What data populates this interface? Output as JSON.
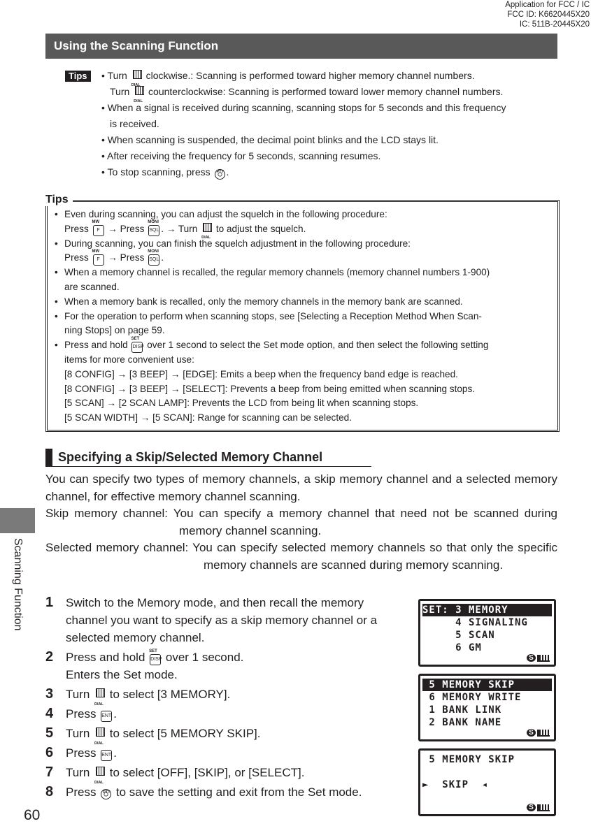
{
  "fcc_header": [
    "Application for FCC / IC",
    "FCC ID: K6620445X20",
    "IC: 511B-20445X20"
  ],
  "header": {
    "title": "Using the Scanning Function"
  },
  "tips_label": "Tips",
  "tips1": [
    {
      "cls": "",
      "seg": [
        {
          "t": "• Turn "
        },
        {
          "icon": "dial"
        },
        {
          "t": " clockwise.: Scanning is performed toward higher memory channel numbers."
        }
      ]
    },
    {
      "cls": "in",
      "seg": [
        {
          "t": "Turn "
        },
        {
          "icon": "dial"
        },
        {
          "t": " counterclockwise: Scanning is performed toward lower memory channel numbers."
        }
      ]
    },
    {
      "cls": "",
      "seg": [
        {
          "t": "• When a signal is received during scanning, scanning stops for 5 seconds and this frequency"
        }
      ]
    },
    {
      "cls": "in",
      "seg": [
        {
          "t": "is received."
        }
      ]
    },
    {
      "cls": "",
      "seg": [
        {
          "t": "• When scanning is suspended, the decimal point blinks and the LCD stays lit."
        }
      ]
    },
    {
      "cls": "",
      "seg": [
        {
          "t": "• After receiving the frequency for 5 seconds, scanning resumes."
        }
      ]
    },
    {
      "cls": "",
      "seg": [
        {
          "t": "• To stop scanning, press "
        },
        {
          "icon": "ptt"
        },
        {
          "t": "."
        }
      ]
    }
  ],
  "tips_box_label": "Tips",
  "tips2": [
    {
      "cls": "b",
      "seg": [
        {
          "t": "Even during scanning, you can adjust the squelch in the following procedure:"
        }
      ]
    },
    {
      "cls": "",
      "seg": [
        {
          "t": "Press "
        },
        {
          "icon": "key",
          "k": "F",
          "l": "MW"
        },
        {
          "t": " → Press "
        },
        {
          "icon": "key",
          "k": "SQL",
          "l": "MONI"
        },
        {
          "t": ". → Turn "
        },
        {
          "icon": "dial"
        },
        {
          "t": " to adjust the squelch."
        }
      ]
    },
    {
      "cls": "b",
      "seg": [
        {
          "t": "During scanning, you can finish the squelch adjustment in the following procedure:"
        }
      ]
    },
    {
      "cls": "",
      "seg": [
        {
          "t": "Press "
        },
        {
          "icon": "key",
          "k": "F",
          "l": "MW"
        },
        {
          "t": " → Press "
        },
        {
          "icon": "key",
          "k": "SQL",
          "l": "MONI"
        },
        {
          "t": "."
        }
      ]
    },
    {
      "cls": "b",
      "seg": [
        {
          "t": "When a memory channel is recalled, the regular memory channels (memory channel numbers 1-900)"
        }
      ]
    },
    {
      "cls": "",
      "seg": [
        {
          "t": "are scanned."
        }
      ]
    },
    {
      "cls": "b",
      "seg": [
        {
          "t": "When a memory bank is recalled, only the memory channels in the memory bank are scanned."
        }
      ]
    },
    {
      "cls": "b",
      "seg": [
        {
          "t": "For the operation to perform when scanning stops, see [Selecting a Reception Method When Scan-"
        }
      ]
    },
    {
      "cls": "",
      "seg": [
        {
          "t": "ning Stops] on page 59."
        }
      ]
    },
    {
      "cls": "b",
      "seg": [
        {
          "t": "Press and hold "
        },
        {
          "icon": "key",
          "k": "DISP",
          "l": "SET"
        },
        {
          "t": " over 1 second to select the Set mode option, and then select the following setting"
        }
      ]
    },
    {
      "cls": "",
      "seg": [
        {
          "t": "items for more convenient use:"
        }
      ]
    },
    {
      "cls": "",
      "seg": [
        {
          "t": "[8 CONFIG] → [3 BEEP] → [EDGE]: Emits a beep when the frequency band edge is reached."
        }
      ]
    },
    {
      "cls": "",
      "seg": [
        {
          "t": "[8 CONFIG] → [3 BEEP] → [SELECT]: Prevents a beep from being emitted when scanning stops."
        }
      ]
    },
    {
      "cls": "",
      "seg": [
        {
          "t": "[5 SCAN] → [2 SCAN LAMP]: Prevents the LCD from being lit when scanning stops."
        }
      ]
    },
    {
      "cls": "",
      "seg": [
        {
          "t": "[5 SCAN WIDTH] → [5 SCAN]: Range for scanning can be selected."
        }
      ]
    }
  ],
  "section": {
    "title": "Specifying a Skip/Selected Memory Channel"
  },
  "body": {
    "intro": "You can specify two types of memory channels, a skip memory channel and a selected memory channel, for effective memory channel scanning.",
    "skip": "Skip memory channel: You can specify a memory channel that need not be scanned during memory channel scanning.",
    "selected": "Selected memory channel: You can specify selected memory channels so that only the specific memory channels are scanned during memory scanning."
  },
  "steps": [
    {
      "n": "1",
      "lines": [
        [
          {
            "t": "Switch to the Memory mode, and then recall the memory"
          }
        ],
        [
          {
            "t": "channel you want to specify as a skip memory channel or a"
          }
        ],
        [
          {
            "t": "selected memory channel."
          }
        ]
      ]
    },
    {
      "n": "2",
      "lines": [
        [
          {
            "t": "Press and hold "
          },
          {
            "icon": "key",
            "k": "DISP",
            "l": "SET"
          },
          {
            "t": " over 1 second."
          }
        ],
        [
          {
            "t": "Enters the Set mode."
          }
        ]
      ]
    },
    {
      "n": "3",
      "lines": [
        [
          {
            "t": "Turn "
          },
          {
            "icon": "dial"
          },
          {
            "t": " to select [3 MEMORY]."
          }
        ]
      ]
    },
    {
      "n": "4",
      "lines": [
        [
          {
            "t": "Press "
          },
          {
            "icon": "key",
            "k": "ENT",
            "l": ""
          },
          {
            "t": "."
          }
        ]
      ]
    },
    {
      "n": "5",
      "lines": [
        [
          {
            "t": "Turn "
          },
          {
            "icon": "dial"
          },
          {
            "t": " to select [5 MEMORY SKIP]."
          }
        ]
      ]
    },
    {
      "n": "6",
      "lines": [
        [
          {
            "t": "Press "
          },
          {
            "icon": "key",
            "k": "ENT",
            "l": ""
          },
          {
            "t": "."
          }
        ]
      ]
    },
    {
      "n": "7",
      "lines": [
        [
          {
            "t": "Turn "
          },
          {
            "icon": "dial"
          },
          {
            "t": " to select [OFF], [SKIP], or [SELECT]."
          }
        ]
      ]
    },
    {
      "n": "8",
      "lines": [
        [
          {
            "t": "Press "
          },
          {
            "icon": "ptt"
          },
          {
            "t": " to save the setting and exit from the Set mode."
          }
        ]
      ]
    }
  ],
  "lcd": [
    {
      "rows": [
        "SET: 3 MEMORY",
        "     4 SIGNALING",
        "     5 SCAN",
        "     6 GM"
      ],
      "hl": 0
    },
    {
      "rows": [
        " 5 MEMORY SKIP",
        " 6 MEMORY WRITE",
        " 1 BANK LINK",
        " 2 BANK NAME"
      ],
      "hl": 0
    },
    {
      "rows": [
        " 5 MEMORY SKIP",
        "",
        "►  SKIP  ◂",
        ""
      ],
      "hl": -1
    }
  ],
  "lcd_status": "S",
  "sidebar": {
    "label": "Scanning Function"
  },
  "page_number": "60"
}
